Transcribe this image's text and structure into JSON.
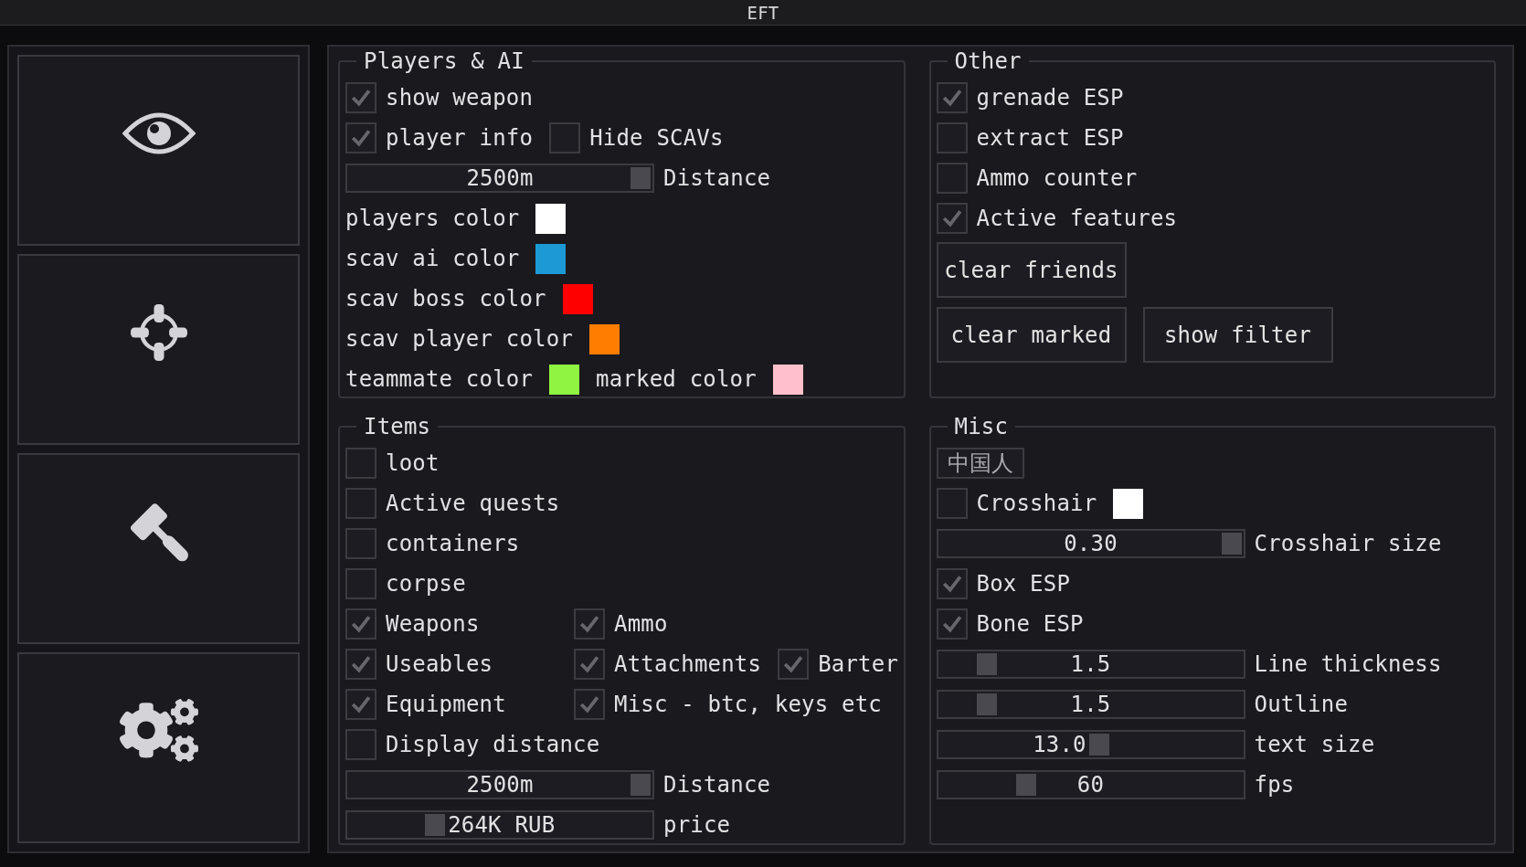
{
  "window": {
    "title": "EFT"
  },
  "groups": [
    {
      "title": "Players & AI",
      "rows": [
        {
          "items": [
            {
              "kind": "checkbox",
              "label": "show weapon",
              "checked": true
            }
          ]
        },
        {
          "items": [
            {
              "kind": "checkbox",
              "label": "player info",
              "checked": true
            },
            {
              "kind": "checkbox",
              "label": "Hide SCAVs",
              "checked": false
            }
          ]
        },
        {
          "items": [
            {
              "kind": "slider",
              "value": "2500m",
              "level": 1,
              "label": "Distance"
            }
          ]
        },
        {
          "items": [
            {
              "kind": "color",
              "label": "players color",
              "color": "#ffffff"
            }
          ]
        },
        {
          "items": [
            {
              "kind": "color",
              "label": "scav ai color",
              "color": "#1c9ad6"
            }
          ]
        },
        {
          "items": [
            {
              "kind": "color",
              "label": "scav boss color",
              "color": "#ff0000"
            }
          ]
        },
        {
          "items": [
            {
              "kind": "color",
              "label": "scav player color",
              "color": "#ff7d00"
            }
          ]
        },
        {
          "items": [
            {
              "kind": "color",
              "label": "teammate color",
              "color": "#8ff542"
            },
            {
              "kind": "color",
              "label": "marked color",
              "color": "#ffc0cb"
            }
          ]
        }
      ]
    },
    {
      "title": "Other",
      "rows": [
        {
          "items": [
            {
              "kind": "checkbox",
              "label": "grenade ESP",
              "checked": true
            }
          ]
        },
        {
          "items": [
            {
              "kind": "checkbox",
              "label": "extract ESP",
              "checked": false
            }
          ]
        },
        {
          "items": [
            {
              "kind": "checkbox",
              "label": "Ammo counter",
              "checked": false
            }
          ]
        },
        {
          "items": [
            {
              "kind": "checkbox",
              "label": "Active features",
              "checked": true
            }
          ]
        },
        {
          "items": [
            {
              "kind": "button",
              "label": "clear friends"
            }
          ]
        },
        {
          "items": [
            {
              "kind": "button",
              "label": "clear marked"
            },
            {
              "kind": "button",
              "label": "show filter"
            }
          ]
        }
      ]
    },
    {
      "title": "Items",
      "rows": [
        {
          "items": [
            {
              "kind": "checkbox",
              "label": "loot",
              "checked": false
            }
          ]
        },
        {
          "items": [
            {
              "kind": "checkbox",
              "label": "Active quests",
              "checked": false
            }
          ]
        },
        {
          "items": [
            {
              "kind": "checkbox",
              "label": "containers",
              "checked": false
            }
          ]
        },
        {
          "items": [
            {
              "kind": "checkbox",
              "label": "corpse",
              "checked": false
            }
          ]
        },
        {
          "items": [
            {
              "kind": "checkbox",
              "label": "Weapons",
              "checked": true
            },
            {
              "kind": "checkbox",
              "label": "Ammo",
              "checked": true
            }
          ]
        },
        {
          "items": [
            {
              "kind": "checkbox",
              "label": "Useables",
              "checked": true
            },
            {
              "kind": "checkbox",
              "label": "Attachments",
              "checked": true
            },
            {
              "kind": "checkbox",
              "label": "Barter",
              "checked": true
            }
          ]
        },
        {
          "items": [
            {
              "kind": "checkbox",
              "label": "Equipment",
              "checked": true
            },
            {
              "kind": "checkbox",
              "label": "Misc - btc, keys etc",
              "checked": true
            }
          ]
        },
        {
          "items": [
            {
              "kind": "checkbox",
              "label": "Display distance",
              "checked": false
            }
          ]
        },
        {
          "items": [
            {
              "kind": "slider",
              "value": "2500m",
              "level": 1,
              "label": "Distance"
            }
          ]
        },
        {
          "items": [
            {
              "kind": "slider",
              "value": "264K RUB",
              "level": 0.27,
              "label": "price"
            }
          ]
        }
      ]
    },
    {
      "title": "Misc",
      "rows": [
        {
          "items": [
            {
              "kind": "small_button",
              "label": "中国人"
            }
          ]
        },
        {
          "items": [
            {
              "kind": "checkbox",
              "label": "Crosshair",
              "checked": false
            },
            {
              "kind": "color",
              "color": "#ffffff"
            }
          ]
        },
        {
          "items": [
            {
              "kind": "slider",
              "value": "0.30",
              "level": 1,
              "label": "Crosshair size"
            }
          ]
        },
        {
          "items": [
            {
              "kind": "checkbox",
              "label": "Box ESP",
              "checked": true
            }
          ]
        },
        {
          "items": [
            {
              "kind": "checkbox",
              "label": "Bone ESP",
              "checked": true
            }
          ]
        },
        {
          "items": [
            {
              "kind": "slider",
              "value": "1.5",
              "level": 0.13,
              "label": "Line thickness"
            }
          ]
        },
        {
          "items": [
            {
              "kind": "slider",
              "value": "1.5",
              "level": 0.13,
              "label": "Outline"
            }
          ]
        },
        {
          "items": [
            {
              "kind": "slider",
              "value": "13.0",
              "level": 0.53,
              "label": "text size"
            }
          ]
        },
        {
          "items": [
            {
              "kind": "slider",
              "value": "60",
              "level": 0.27,
              "label": "fps"
            }
          ]
        }
      ]
    }
  ]
}
